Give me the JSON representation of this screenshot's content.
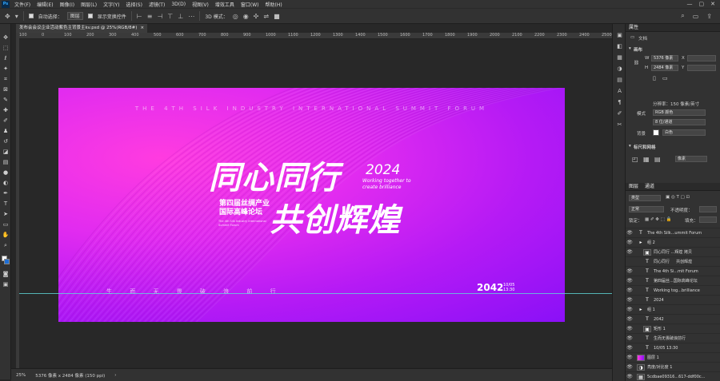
{
  "menu": {
    "logo": "Ps",
    "items": [
      "文件(F)",
      "编辑(E)",
      "图像(I)",
      "图层(L)",
      "文字(Y)",
      "选择(S)",
      "滤镜(T)",
      "3D(D)",
      "视图(V)",
      "增效工具",
      "窗口(W)",
      "帮助(H)"
    ],
    "window_controls": [
      "—",
      "▢",
      "✕"
    ]
  },
  "options": {
    "auto_select_label": "自动选择：",
    "auto_select_value": "图层",
    "show_transform_label": "显示变换控件",
    "mode_3d_label": "3D 模式："
  },
  "document": {
    "tab_title": "发布会会议企业活动紫色主背景主kv.psd @ 25%(RGB/8#)",
    "tab_close": "×"
  },
  "ruler": {
    "marks": [
      "100",
      "0",
      "100",
      "200",
      "300",
      "400",
      "500",
      "600",
      "700",
      "800",
      "900",
      "1000",
      "1100",
      "1200",
      "1300",
      "1400",
      "1500",
      "1600",
      "1700",
      "1800",
      "1900",
      "2000",
      "2100",
      "2200",
      "2300",
      "2400",
      "2500"
    ]
  },
  "banner": {
    "en_title": "THE 4TH SILK INDUSTRY INTERNATIONAL SUMMIT FORUM",
    "main_line1": "同心同行",
    "main_line2": "共创辉煌",
    "year": "2024",
    "sub_en_1": "Working together to",
    "sub_en_2": "create brilliance",
    "cn_line1": "第四届丝绸产业",
    "cn_line2": "国际高峰论坛",
    "cn_en_1": "The 4th Silk Industry International",
    "cn_en_2": "Summit Forum",
    "slogan": "生 而 无 畏 破 浪 前 行",
    "date_big": "2042",
    "date_small_1": "10/05",
    "date_small_2": "13:30",
    "colors": {
      "pink": "#ff3be0",
      "violet": "#8a10f7"
    }
  },
  "status": {
    "zoom": "25%",
    "size": "5376 像素 x 2484 像素 (150 ppi)"
  },
  "properties": {
    "tab": "属性",
    "doc_label": "文档",
    "canvas_section": "画布",
    "w_label": "W",
    "w_value": "5376 像素",
    "h_label": "H",
    "h_value": "2484 像素",
    "x_label": "X",
    "y_label": "Y",
    "resolution": "分辨率：150 像素/英寸",
    "mode_label": "模式",
    "mode_value": "RGB 颜色",
    "depth_value": "8 位/通道",
    "bg_label": "背景",
    "bg_value": "白色",
    "rulers_section": "标尺和网格",
    "units_value": "像素"
  },
  "layers_panel": {
    "tab_layers": "图层",
    "tab_channels": "通道",
    "filter_value": "类型",
    "blend_value": "正常",
    "opacity_label": "不透明度：",
    "lock_label": "锁定：",
    "fill_label": "填充：",
    "layers": [
      {
        "name": "The 4th Silk...ummit Forum",
        "kind": "T",
        "indent": 0
      },
      {
        "name": "组 2",
        "kind": "folder",
        "indent": 0
      },
      {
        "name": "同心同行 ...辉煌 拷贝",
        "kind": "smart",
        "indent": 1
      },
      {
        "name": "同心同行 　 共创辉煌",
        "kind": "T",
        "indent": 1
      },
      {
        "name": "The 4th Si...mit Forum",
        "kind": "T",
        "indent": 1
      },
      {
        "name": "第四届丝...国际高峰论坛",
        "kind": "T",
        "indent": 1
      },
      {
        "name": "Working tog...brilliance",
        "kind": "T",
        "indent": 1
      },
      {
        "name": "2024",
        "kind": "T",
        "indent": 1
      },
      {
        "name": "组 1",
        "kind": "folder",
        "indent": 0
      },
      {
        "name": "2042",
        "kind": "T",
        "indent": 1
      },
      {
        "name": "矩形 1",
        "kind": "smart",
        "indent": 1
      },
      {
        "name": "生而无畏破浪前行",
        "kind": "T",
        "indent": 1
      },
      {
        "name": "10/05 13:30",
        "kind": "T",
        "indent": 1
      },
      {
        "name": "图层 1",
        "kind": "purple",
        "indent": 0
      },
      {
        "name": "亮度/对比度 1",
        "kind": "adjust",
        "indent": 0
      },
      {
        "name": "5cdbae09316...617-ddf00c...",
        "kind": "image",
        "indent": 0
      }
    ]
  }
}
